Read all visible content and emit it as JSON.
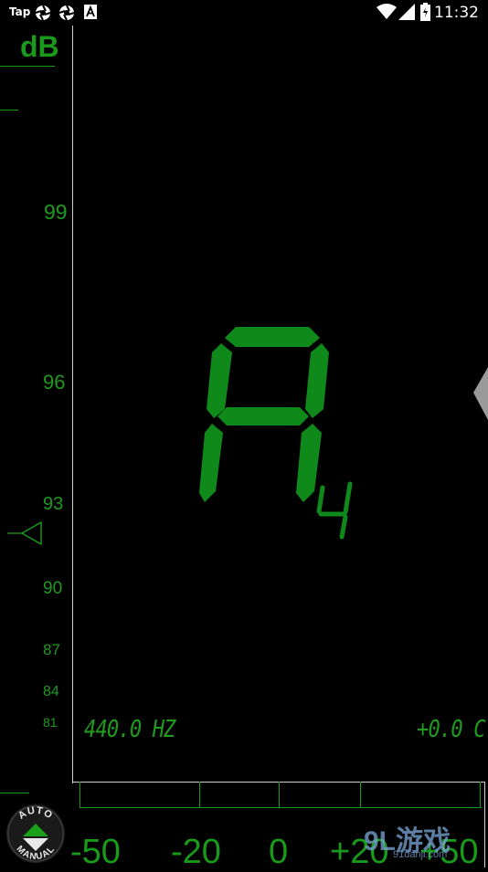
{
  "status_bar": {
    "app_label": "Tap",
    "time": "11:32"
  },
  "db_scale": {
    "title": "dB",
    "ticks": [
      "99",
      "96",
      "93",
      "90",
      "87",
      "84",
      "81"
    ]
  },
  "note": {
    "letter": "A",
    "octave": "4"
  },
  "readout": {
    "frequency": "440.0 HZ",
    "cents": "+0.0 C"
  },
  "cents_scale": {
    "labels": [
      "-50",
      "-20",
      "0",
      "+20",
      "+50"
    ]
  },
  "mode_button": {
    "top_label": "AUTO",
    "bottom_label": "MANUAL"
  },
  "watermark": {
    "logo": "9L游戏",
    "site": "91danji.com"
  },
  "colors": {
    "accent_green": "#1a9a1a",
    "background": "#000000"
  }
}
